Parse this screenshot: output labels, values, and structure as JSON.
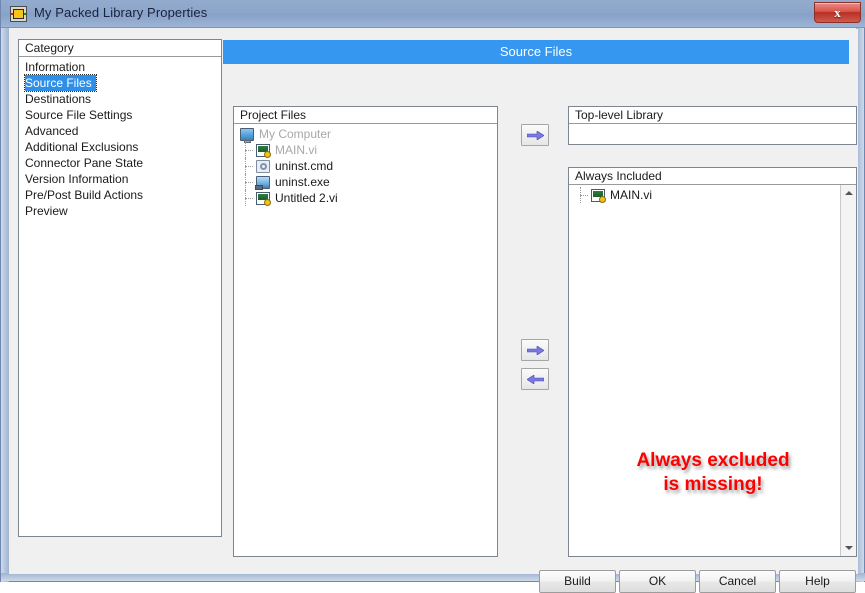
{
  "window": {
    "title": "My Packed Library Properties",
    "icon": "labview-vi-icon",
    "close_label": "x"
  },
  "category_panel": {
    "header": "Category",
    "selected": "Source Files",
    "items": [
      {
        "label": "Information",
        "selected": false
      },
      {
        "label": "Source Files",
        "selected": true
      },
      {
        "label": "Destinations",
        "selected": false
      },
      {
        "label": "Source File Settings",
        "selected": false
      },
      {
        "label": "Advanced",
        "selected": false
      },
      {
        "label": "Additional Exclusions",
        "selected": false
      },
      {
        "label": "Connector Pane State",
        "selected": false
      },
      {
        "label": "Version Information",
        "selected": false
      },
      {
        "label": "Pre/Post Build Actions",
        "selected": false
      },
      {
        "label": "Preview",
        "selected": false
      }
    ]
  },
  "banner": {
    "title": "Source Files",
    "color": "#3597ef"
  },
  "project_files": {
    "header": "Project Files",
    "rows": [
      {
        "label": "My Computer",
        "icon": "monitor-icon",
        "dim": true,
        "depth": 0,
        "expanded": true
      },
      {
        "label": "MAIN.vi",
        "icon": "vi-icon",
        "dim": true,
        "depth": 1
      },
      {
        "label": "uninst.cmd",
        "icon": "cmd-icon",
        "dim": false,
        "depth": 1
      },
      {
        "label": "uninst.exe",
        "icon": "exe-icon",
        "dim": false,
        "depth": 1
      },
      {
        "label": "Untitled 2.vi",
        "icon": "vi-icon",
        "dim": false,
        "depth": 1
      }
    ]
  },
  "toplevel_library": {
    "header": "Top-level Library",
    "rows": []
  },
  "always_included": {
    "header": "Always Included",
    "rows": [
      {
        "label": "MAIN.vi",
        "icon": "vi-icon",
        "dim": false,
        "depth": 1
      }
    ],
    "scrollbar": true
  },
  "transfer_buttons": [
    {
      "name": "add-to-toplevel",
      "direction": "right"
    },
    {
      "name": "add-to-always-included",
      "direction": "right"
    },
    {
      "name": "remove-from-always-included",
      "direction": "left"
    }
  ],
  "annotation": {
    "line1": "Always excluded",
    "line2": "is missing!",
    "color": "#ff0000"
  },
  "dialog_buttons": {
    "build": "Build",
    "ok": "OK",
    "cancel": "Cancel",
    "help": "Help"
  }
}
